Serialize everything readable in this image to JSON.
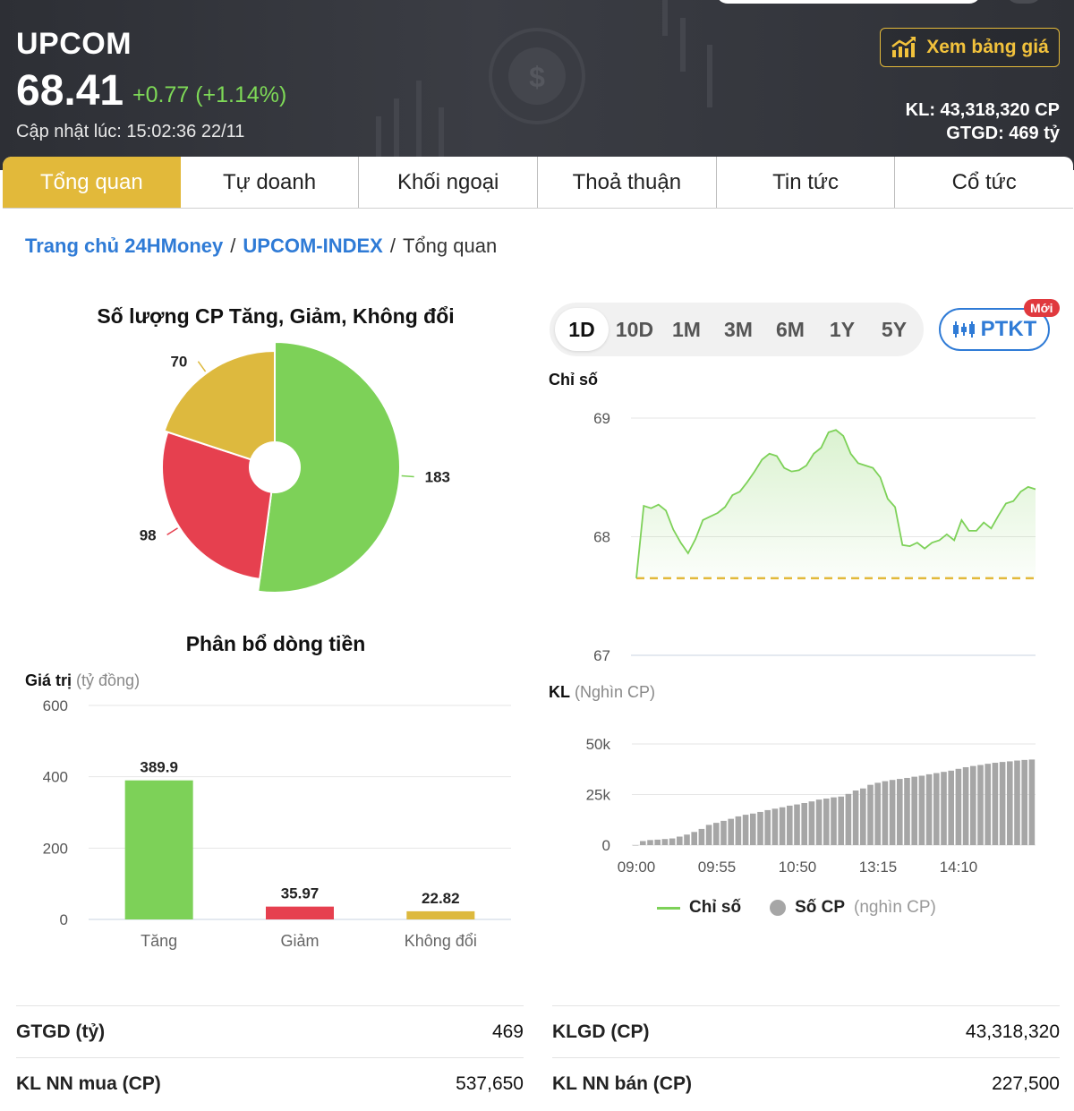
{
  "header": {
    "symbol": "UPCOM",
    "price": "68.41",
    "change": "+0.77 (+1.14%)",
    "updated": "Cập nhật lúc: 15:02:36 22/11",
    "price_board_button": "Xem bảng giá",
    "volume": "KL: 43,318,320 CP",
    "value": "GTGD: 469 tỷ",
    "colors": {
      "background": "#33353b",
      "accent": "#e2b93a",
      "up": "#7ed957"
    }
  },
  "tabs": [
    {
      "label": "Tổng quan",
      "active": true
    },
    {
      "label": "Tự doanh"
    },
    {
      "label": "Khối ngoại"
    },
    {
      "label": "Thoả thuận"
    },
    {
      "label": "Tin tức"
    },
    {
      "label": "Cổ tức"
    }
  ],
  "breadcrumb": {
    "home": "Trang chủ 24HMoney",
    "index": "UPCOM-INDEX",
    "current": "Tổng quan"
  },
  "pie_title": "Số lượng CP Tăng, Giảm, Không đổi",
  "bar_title": "Phân bổ dòng tiền",
  "bar_axis_title": "Giá trị",
  "bar_axis_unit": "(tỷ đồng)",
  "range_options": [
    "1D",
    "10D",
    "1M",
    "3M",
    "6M",
    "1Y",
    "5Y"
  ],
  "range_selected": "1D",
  "ptkt_label": "PTKT",
  "new_badge": "Mới",
  "line_axis_title": "Chỉ số",
  "volume_axis_title": "KL",
  "volume_axis_unit": "(Nghìn CP)",
  "legend": {
    "index": "Chỉ số",
    "volume": "Số CP",
    "volume_unit": "(nghìn CP)"
  },
  "stats": {
    "left": [
      {
        "label": "GTGD (tỷ)",
        "value": "469"
      },
      {
        "label": "KL NN mua (CP)",
        "value": "537,650"
      }
    ],
    "right": [
      {
        "label": "KLGD (CP)",
        "value": "43,318,320"
      },
      {
        "label": "KL NN bán (CP)",
        "value": "227,500"
      }
    ]
  },
  "chart_data": [
    {
      "type": "pie",
      "title": "Số lượng CP Tăng, Giảm, Không đổi",
      "categories": [
        "Tăng",
        "Giảm",
        "Không đổi"
      ],
      "values": [
        183,
        98,
        70
      ],
      "colors": [
        "#7dd158",
        "#e6404f",
        "#ddb93e"
      ]
    },
    {
      "type": "bar",
      "title": "Phân bổ dòng tiền",
      "categories": [
        "Tăng",
        "Giảm",
        "Không đổi"
      ],
      "values": [
        389.9,
        35.97,
        22.82
      ],
      "labels": [
        "389.9",
        "35.97",
        "22.82"
      ],
      "colors": [
        "#7dd158",
        "#e6404f",
        "#ddb93e"
      ],
      "ylabel": "Giá trị (tỷ đồng)",
      "yticks": [
        0,
        200,
        400,
        600
      ],
      "ylim": [
        0,
        600
      ],
      "grid": true
    },
    {
      "type": "line",
      "ylabel": "Chỉ số",
      "ylim": [
        67,
        69
      ],
      "yticks": [
        67,
        68,
        69
      ],
      "reference": 67.65,
      "values": [
        67.65,
        68.26,
        68.24,
        68.27,
        68.22,
        68.06,
        67.95,
        67.86,
        67.98,
        68.14,
        68.17,
        68.2,
        68.25,
        68.35,
        68.38,
        68.46,
        68.55,
        68.65,
        68.7,
        68.68,
        68.58,
        68.55,
        68.56,
        68.6,
        68.7,
        68.75,
        68.88,
        68.9,
        68.85,
        68.7,
        68.62,
        68.6,
        68.58,
        68.5,
        68.32,
        68.25,
        67.93,
        67.92,
        67.95,
        67.9,
        67.95,
        67.97,
        68.02,
        67.97,
        68.14,
        68.05,
        68.05,
        68.12,
        68.07,
        68.18,
        68.28,
        68.3,
        68.38,
        68.42,
        68.4
      ],
      "color": "#7dd158"
    },
    {
      "type": "bar",
      "ylabel": "KL (Nghìn CP)",
      "ylim": [
        0,
        50000
      ],
      "yticks": [
        "0",
        "25k",
        "50k"
      ],
      "xticks": [
        "09:00",
        "09:55",
        "10:50",
        "13:15",
        "14:10"
      ],
      "values": [
        0,
        2000,
        2500,
        2700,
        3000,
        3300,
        4200,
        5200,
        6500,
        8000,
        10000,
        11000,
        12000,
        13000,
        14200,
        15000,
        15600,
        16400,
        17300,
        18000,
        18700,
        19500,
        20100,
        20800,
        21600,
        22500,
        23000,
        23600,
        24000,
        25300,
        27000,
        28000,
        29800,
        30800,
        31600,
        32200,
        32700,
        33200,
        33800,
        34300,
        35000,
        35600,
        36200,
        36800,
        37700,
        38500,
        39100,
        39600,
        40200,
        40700,
        41100,
        41400,
        41800,
        42100,
        42300
      ],
      "color": "#a6a6a6"
    }
  ]
}
